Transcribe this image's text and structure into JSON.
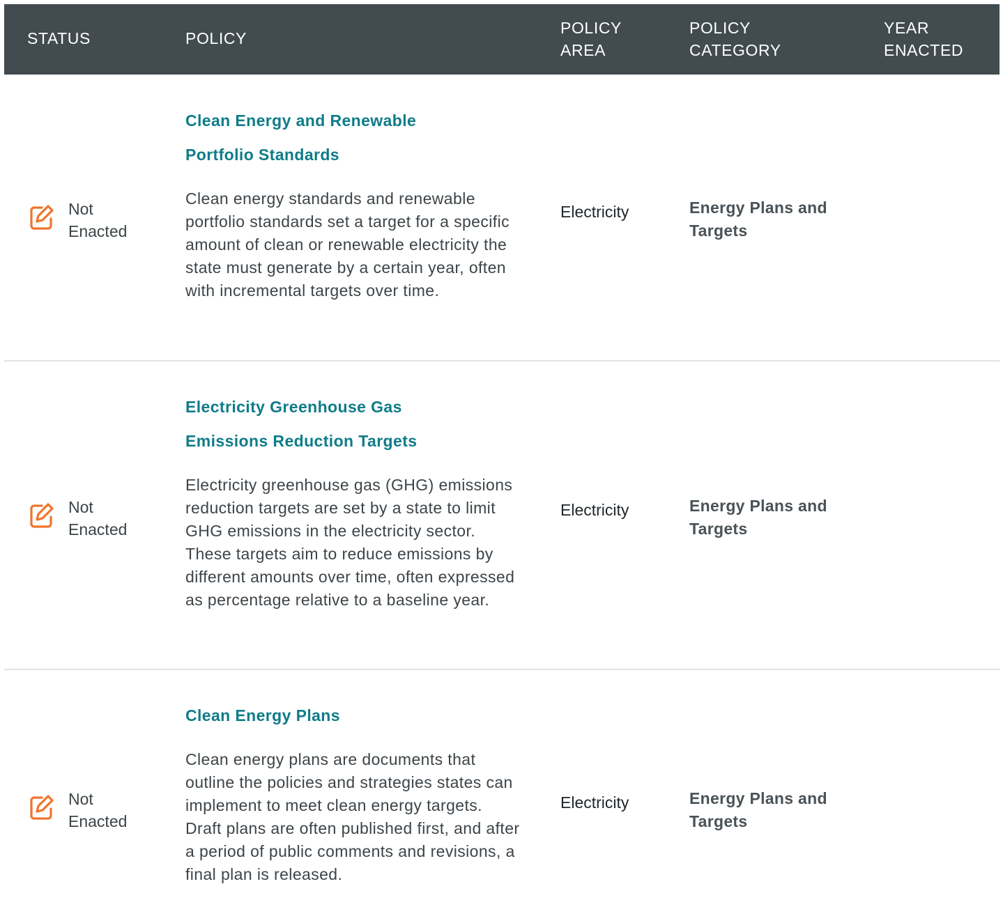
{
  "header": {
    "status": "STATUS",
    "policy": "POLICY",
    "policy_area": "POLICY AREA",
    "policy_category": "POLICY CATEGORY",
    "year_enacted": "YEAR ENACTED"
  },
  "colors": {
    "header_bg": "#424b4f",
    "link": "#0f7c89",
    "status_icon": "#f0742c",
    "divider": "#dfe3e5"
  },
  "rows": [
    {
      "status": "Not Enacted",
      "status_icon": "edit-icon",
      "title_line1": "Clean Energy and Renewable",
      "title_line2": "Portfolio Standards",
      "description": "Clean energy standards and renewable portfolio standards set a target for a specific amount of clean or renewable electricity the state must generate by a certain year, often with incremental targets over time.",
      "policy_area": "Electricity",
      "policy_category": "Energy Plans and Targets",
      "year_enacted": ""
    },
    {
      "status": "Not Enacted",
      "status_icon": "edit-icon",
      "title_line1": "Electricity Greenhouse Gas",
      "title_line2": "Emissions Reduction Targets",
      "description": "Electricity greenhouse gas (GHG) emissions reduction targets are set by a state to limit GHG emissions in the electricity sector. These targets aim to reduce emissions by different amounts over time, often expressed as percentage relative to a baseline year.",
      "policy_area": "Electricity",
      "policy_category": "Energy Plans and Targets",
      "year_enacted": ""
    },
    {
      "status": "Not Enacted",
      "status_icon": "edit-icon",
      "title_line1": "Clean Energy Plans",
      "description": "Clean energy plans are documents that outline the policies and strategies states can implement to meet clean energy targets. Draft plans are often published first, and after a period of public comments and revisions, a final plan is released.",
      "policy_area": "Electricity",
      "policy_category": "Energy Plans and Targets",
      "year_enacted": ""
    }
  ]
}
